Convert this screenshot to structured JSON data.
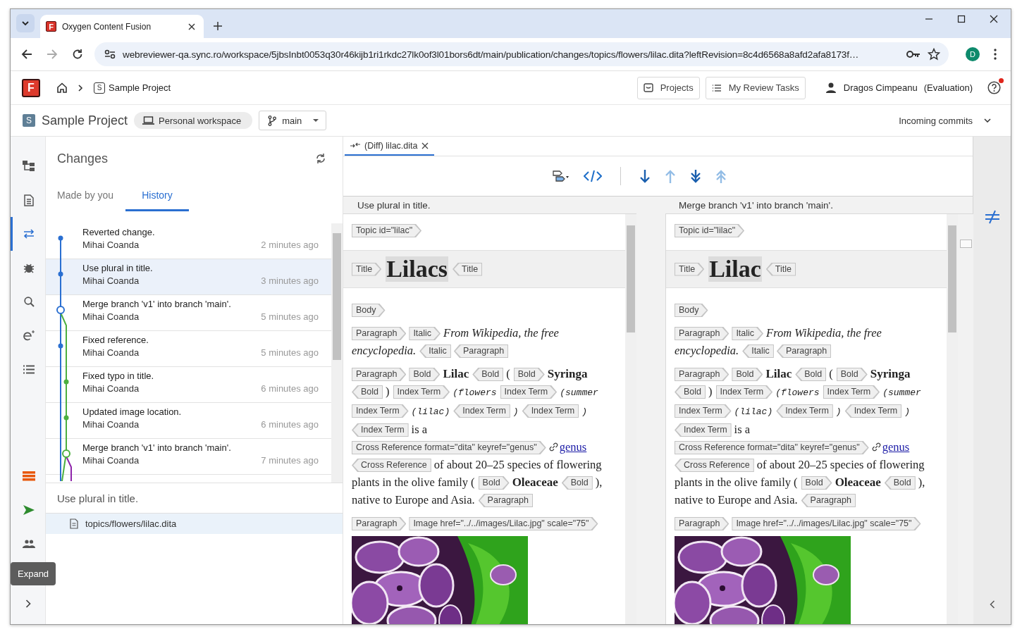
{
  "browser": {
    "tabs": [
      {
        "favicon_letter": "F",
        "title": "Oxygen Content Fusion",
        "selected": true
      }
    ],
    "nav_buttons": [
      {
        "kind": "back",
        "disabled": false
      },
      {
        "kind": "forward",
        "disabled": true
      },
      {
        "kind": "reload",
        "disabled": false
      }
    ],
    "url": "webreviewer-qa.sync.ro/workspace/5jbsInbt0053q30r46kijb1ri1rkdc27lk0of3l01bors6dt/main/publication/changes/topics/flowers/lilac.dita?leftRevision=8c4d6568a8afd2afa8173f…",
    "profile_initial": "D"
  },
  "app_header": {
    "logo_letter": "F",
    "breadcrumb_badge": "S",
    "breadcrumb": "Sample Project",
    "buttons": [
      {
        "kind": "projects",
        "label": "Projects"
      },
      {
        "kind": "tasks",
        "label": "My Review Tasks"
      }
    ],
    "user": "Dragos Cimpeanu",
    "user_note": "(Evaluation)",
    "help_notification": true
  },
  "project_bar": {
    "badge": "S",
    "name": "Sample Project",
    "workspace": "Personal workspace",
    "branch": "main",
    "incoming": "Incoming commits"
  },
  "rail_top": [
    {
      "kind": "structure",
      "selected": false
    },
    {
      "kind": "document",
      "selected": false
    },
    {
      "kind": "changes",
      "selected": true
    },
    {
      "kind": "bug",
      "selected": false
    },
    {
      "kind": "search",
      "selected": false
    },
    {
      "kind": "edit",
      "selected": false
    },
    {
      "kind": "list",
      "selected": false
    }
  ],
  "rail_bottom": [
    {
      "kind": "stack",
      "selected": false
    },
    {
      "kind": "send",
      "selected": false
    },
    {
      "kind": "people",
      "selected": false
    }
  ],
  "rail_tooltip": "Expand",
  "changes": {
    "title": "Changes",
    "tabs": [
      {
        "label": "Made by you",
        "selected": false
      },
      {
        "label": "History",
        "selected": true
      }
    ],
    "commits": [
      {
        "message": "Reverted change.",
        "author": "Mihai Coanda",
        "time": "2 minutes ago",
        "selected": false
      },
      {
        "message": "Use plural in title.",
        "author": "Mihai Coanda",
        "time": "3 minutes ago",
        "selected": true
      },
      {
        "message": "Merge branch 'v1' into branch 'main'.",
        "author": "Mihai Coanda",
        "time": "5 minutes ago",
        "selected": false
      },
      {
        "message": "Fixed reference.",
        "author": "Mihai Coanda",
        "time": "5 minutes ago",
        "selected": false
      },
      {
        "message": "Fixed typo in title.",
        "author": "Mihai Coanda",
        "time": "6 minutes ago",
        "selected": false
      },
      {
        "message": "Updated image location.",
        "author": "Mihai Coanda",
        "time": "6 minutes ago",
        "selected": false
      },
      {
        "message": "Merge branch 'v1' into branch 'main'.",
        "author": "Mihai Coanda",
        "time": "7 minutes ago",
        "selected": false
      }
    ],
    "detail_message": "Use plural in title.",
    "files": [
      {
        "path": "topics/flowers/lilac.dita",
        "selected": true
      }
    ]
  },
  "diff": {
    "tabs": [
      {
        "label": "(Diff) lilac.dita",
        "selected": true
      }
    ],
    "toolbar": [
      {
        "kind": "layout",
        "disabled": false
      },
      {
        "kind": "source",
        "disabled": false
      },
      {
        "kind": "next",
        "disabled": false
      },
      {
        "kind": "prev",
        "disabled": true
      },
      {
        "kind": "last",
        "disabled": false
      },
      {
        "kind": "first",
        "disabled": true
      }
    ],
    "panes": [
      {
        "header": "Use plural in title.",
        "blocks": [
          {
            "kind": "line",
            "tokens": [
              {
                "kind": "open",
                "text": "Topic id=\"lilac\""
              }
            ]
          },
          {
            "kind": "title",
            "tokens": [
              {
                "kind": "open",
                "text": "Title"
              },
              {
                "kind": "title",
                "text": "Lilacs",
                "changed": true
              },
              {
                "kind": "close",
                "text": "Title"
              }
            ]
          },
          {
            "kind": "line",
            "tokens": [
              {
                "kind": "open",
                "text": "Body"
              }
            ]
          },
          {
            "kind": "line",
            "tokens": [
              {
                "kind": "open",
                "text": "Paragraph"
              },
              {
                "kind": "open",
                "text": "Italic"
              },
              {
                "kind": "italic",
                "text": "From Wikipedia, the free"
              },
              {
                "kind": "italic",
                "text": "encyclopedia."
              },
              {
                "kind": "close",
                "text": "Italic"
              },
              {
                "kind": "close",
                "text": "Paragraph"
              }
            ]
          },
          {
            "kind": "line",
            "tokens": [
              {
                "kind": "open",
                "text": "Paragraph"
              },
              {
                "kind": "open",
                "text": "Bold"
              },
              {
                "kind": "bold",
                "text": "Lilac"
              },
              {
                "kind": "close",
                "text": "Bold"
              },
              {
                "kind": "text",
                "text": "("
              },
              {
                "kind": "open",
                "text": "Bold"
              },
              {
                "kind": "bold",
                "text": "Syringa"
              },
              {
                "kind": "close",
                "text": "Bold"
              },
              {
                "kind": "text",
                "text": ")"
              },
              {
                "kind": "open",
                "text": "Index Term"
              },
              {
                "kind": "mono",
                "text": "(flowers"
              },
              {
                "kind": "open",
                "text": "Index Term"
              },
              {
                "kind": "mono",
                "text": "(summer"
              },
              {
                "kind": "open",
                "text": "Index Term"
              },
              {
                "kind": "mono",
                "text": "(lilac)"
              },
              {
                "kind": "close",
                "text": "Index Term"
              },
              {
                "kind": "mono",
                "text": ")"
              },
              {
                "kind": "close",
                "text": "Index Term"
              },
              {
                "kind": "mono",
                "text": ")"
              },
              {
                "kind": "close",
                "text": "Index Term"
              },
              {
                "kind": "text",
                "text": "is a"
              },
              {
                "kind": "open",
                "text": "Cross Reference format=\"dita\" keyref=\"genus\""
              },
              {
                "kind": "link",
                "text": "genus"
              },
              {
                "kind": "close",
                "text": "Cross Reference"
              },
              {
                "kind": "text",
                "text": "of about 20–25 species of flowering"
              },
              {
                "kind": "text",
                "text": "plants in the olive family ("
              },
              {
                "kind": "open",
                "text": "Bold"
              },
              {
                "kind": "bold",
                "text": "Oleaceae"
              },
              {
                "kind": "close",
                "text": "Bold"
              },
              {
                "kind": "text",
                "text": "),"
              },
              {
                "kind": "text",
                "text": "native to Europe and Asia."
              },
              {
                "kind": "close",
                "text": "Paragraph"
              }
            ]
          },
          {
            "kind": "line",
            "tokens": [
              {
                "kind": "open",
                "text": "Paragraph"
              },
              {
                "kind": "open",
                "text": "Image href=\"../../images/Lilac.jpg\" scale=\"75\""
              },
              {
                "kind": "picture"
              }
            ]
          }
        ]
      },
      {
        "header": "Merge branch 'v1' into branch 'main'.",
        "blocks": [
          {
            "kind": "line",
            "tokens": [
              {
                "kind": "open",
                "text": "Topic id=\"lilac\""
              }
            ]
          },
          {
            "kind": "title",
            "tokens": [
              {
                "kind": "open",
                "text": "Title"
              },
              {
                "kind": "title",
                "text": "Lilac",
                "changed": true
              },
              {
                "kind": "close",
                "text": "Title"
              }
            ]
          },
          {
            "kind": "line",
            "tokens": [
              {
                "kind": "open",
                "text": "Body"
              }
            ]
          },
          {
            "kind": "line",
            "tokens": [
              {
                "kind": "open",
                "text": "Paragraph"
              },
              {
                "kind": "open",
                "text": "Italic"
              },
              {
                "kind": "italic",
                "text": "From Wikipedia, the free"
              },
              {
                "kind": "italic",
                "text": "encyclopedia."
              },
              {
                "kind": "close",
                "text": "Italic"
              },
              {
                "kind": "close",
                "text": "Paragraph"
              }
            ]
          },
          {
            "kind": "line",
            "tokens": [
              {
                "kind": "open",
                "text": "Paragraph"
              },
              {
                "kind": "open",
                "text": "Bold"
              },
              {
                "kind": "bold",
                "text": "Lilac"
              },
              {
                "kind": "close",
                "text": "Bold"
              },
              {
                "kind": "text",
                "text": "("
              },
              {
                "kind": "open",
                "text": "Bold"
              },
              {
                "kind": "bold",
                "text": "Syringa"
              },
              {
                "kind": "close",
                "text": "Bold"
              },
              {
                "kind": "text",
                "text": ")"
              },
              {
                "kind": "open",
                "text": "Index Term"
              },
              {
                "kind": "mono",
                "text": "(flowers"
              },
              {
                "kind": "open",
                "text": "Index Term"
              },
              {
                "kind": "mono",
                "text": "(summer"
              },
              {
                "kind": "open",
                "text": "Index Term"
              },
              {
                "kind": "mono",
                "text": "(lilac)"
              },
              {
                "kind": "close",
                "text": "Index Term"
              },
              {
                "kind": "mono",
                "text": ")"
              },
              {
                "kind": "close",
                "text": "Index Term"
              },
              {
                "kind": "mono",
                "text": ")"
              },
              {
                "kind": "close",
                "text": "Index Term"
              },
              {
                "kind": "text",
                "text": "is a"
              },
              {
                "kind": "open",
                "text": "Cross Reference format=\"dita\" keyref=\"genus\""
              },
              {
                "kind": "link",
                "text": "genus"
              },
              {
                "kind": "close",
                "text": "Cross Reference"
              },
              {
                "kind": "text",
                "text": "of about 20–25 species of flowering"
              },
              {
                "kind": "text",
                "text": "plants in the olive family ("
              },
              {
                "kind": "open",
                "text": "Bold"
              },
              {
                "kind": "bold",
                "text": "Oleaceae"
              },
              {
                "kind": "close",
                "text": "Bold"
              },
              {
                "kind": "text",
                "text": "),"
              },
              {
                "kind": "text",
                "text": "native to Europe and Asia."
              },
              {
                "kind": "close",
                "text": "Paragraph"
              }
            ]
          },
          {
            "kind": "line",
            "tokens": [
              {
                "kind": "open",
                "text": "Paragraph"
              },
              {
                "kind": "open",
                "text": "Image href=\"../../images/Lilac.jpg\" scale=\"75\""
              },
              {
                "kind": "picture"
              }
            ]
          }
        ]
      }
    ]
  }
}
